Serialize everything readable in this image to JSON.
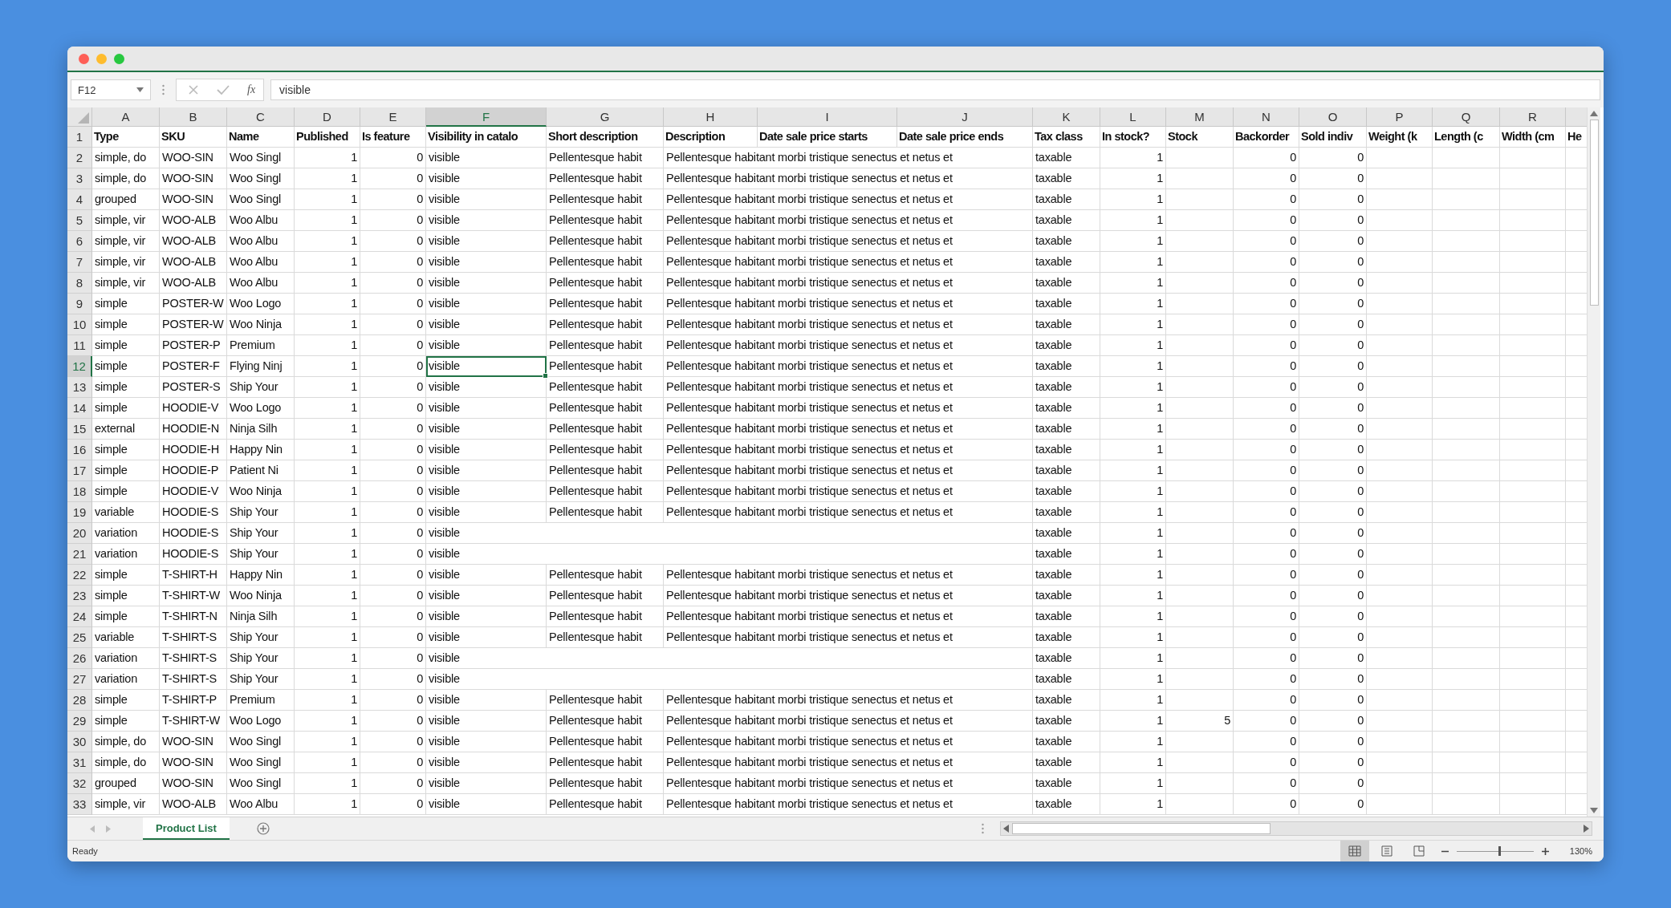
{
  "formula_bar": {
    "name_box": "F12",
    "function_label": "fx",
    "value": "visible"
  },
  "columns": [
    {
      "label": "A",
      "kind": "text",
      "selected": false
    },
    {
      "label": "B",
      "kind": "text",
      "selected": false
    },
    {
      "label": "C",
      "kind": "text",
      "selected": false
    },
    {
      "label": "D",
      "kind": "number",
      "selected": false
    },
    {
      "label": "E",
      "kind": "number",
      "selected": false
    },
    {
      "label": "F",
      "kind": "text",
      "selected": true
    },
    {
      "label": "G",
      "kind": "text",
      "selected": false
    },
    {
      "label": "H",
      "kind": "text",
      "selected": false
    },
    {
      "label": "I",
      "kind": "text",
      "selected": false
    },
    {
      "label": "J",
      "kind": "text",
      "selected": false
    },
    {
      "label": "K",
      "kind": "text",
      "selected": false
    },
    {
      "label": "L",
      "kind": "number",
      "selected": false
    },
    {
      "label": "M",
      "kind": "number",
      "selected": false
    },
    {
      "label": "N",
      "kind": "number",
      "selected": false
    },
    {
      "label": "O",
      "kind": "number",
      "selected": false
    },
    {
      "label": "P",
      "kind": "text",
      "selected": false
    },
    {
      "label": "Q",
      "kind": "text",
      "selected": false
    },
    {
      "label": "R",
      "kind": "text",
      "selected": false
    },
    {
      "kind": "text",
      "selected": false
    }
  ],
  "rows": [
    {
      "number": "1",
      "kind": "header",
      "selected": false,
      "cells": [
        "Type",
        "SKU",
        "Name",
        "Published",
        "Is feature",
        "Visibility in catalo",
        "Short description",
        "Description",
        "Date sale price starts",
        "Date sale price ends",
        "Tax class",
        "In stock?",
        "Stock",
        "Backorder",
        "Sold indiv",
        "Weight (k",
        "Length (c",
        "Width (cm",
        "He"
      ]
    },
    {
      "number": "2",
      "kind": "data",
      "selected": false,
      "cells": [
        "simple, do",
        "WOO-SIN",
        "Woo Singl",
        "1",
        "0",
        "visible",
        "Pellentesque habit",
        "Pellentesque habitant morbi tristique senectus et netus et",
        null,
        null,
        "taxable",
        "1",
        null,
        "0",
        "0",
        null,
        null,
        null,
        null
      ]
    },
    {
      "number": "3",
      "kind": "data",
      "selected": false,
      "cells": [
        "simple, do",
        "WOO-SIN",
        "Woo Singl",
        "1",
        "0",
        "visible",
        "Pellentesque habit",
        "Pellentesque habitant morbi tristique senectus et netus et",
        null,
        null,
        "taxable",
        "1",
        null,
        "0",
        "0",
        null,
        null,
        null,
        null
      ]
    },
    {
      "number": "4",
      "kind": "data",
      "selected": false,
      "cells": [
        "grouped",
        "WOO-SIN",
        "Woo Singl",
        "1",
        "0",
        "visible",
        "Pellentesque habit",
        "Pellentesque habitant morbi tristique senectus et netus et",
        null,
        null,
        "taxable",
        "1",
        null,
        "0",
        "0",
        null,
        null,
        null,
        null
      ]
    },
    {
      "number": "5",
      "kind": "data",
      "selected": false,
      "cells": [
        "simple, vir",
        "WOO-ALB",
        "Woo Albu",
        "1",
        "0",
        "visible",
        "Pellentesque habit",
        "Pellentesque habitant morbi tristique senectus et netus et",
        null,
        null,
        "taxable",
        "1",
        null,
        "0",
        "0",
        null,
        null,
        null,
        null
      ]
    },
    {
      "number": "6",
      "kind": "data",
      "selected": false,
      "cells": [
        "simple, vir",
        "WOO-ALB",
        "Woo Albu",
        "1",
        "0",
        "visible",
        "Pellentesque habit",
        "Pellentesque habitant morbi tristique senectus et netus et",
        null,
        null,
        "taxable",
        "1",
        null,
        "0",
        "0",
        null,
        null,
        null,
        null
      ]
    },
    {
      "number": "7",
      "kind": "data",
      "selected": false,
      "cells": [
        "simple, vir",
        "WOO-ALB",
        "Woo Albu",
        "1",
        "0",
        "visible",
        "Pellentesque habit",
        "Pellentesque habitant morbi tristique senectus et netus et",
        null,
        null,
        "taxable",
        "1",
        null,
        "0",
        "0",
        null,
        null,
        null,
        null
      ]
    },
    {
      "number": "8",
      "kind": "data",
      "selected": false,
      "cells": [
        "simple, vir",
        "WOO-ALB",
        "Woo Albu",
        "1",
        "0",
        "visible",
        "Pellentesque habit",
        "Pellentesque habitant morbi tristique senectus et netus et",
        null,
        null,
        "taxable",
        "1",
        null,
        "0",
        "0",
        null,
        null,
        null,
        null
      ]
    },
    {
      "number": "9",
      "kind": "data",
      "selected": false,
      "cells": [
        "simple",
        "POSTER-W",
        "Woo Logo",
        "1",
        "0",
        "visible",
        "Pellentesque habit",
        "Pellentesque habitant morbi tristique senectus et netus et",
        null,
        null,
        "taxable",
        "1",
        null,
        "0",
        "0",
        null,
        null,
        null,
        null
      ]
    },
    {
      "number": "10",
      "kind": "data",
      "selected": false,
      "cells": [
        "simple",
        "POSTER-W",
        "Woo Ninja",
        "1",
        "0",
        "visible",
        "Pellentesque habit",
        "Pellentesque habitant morbi tristique senectus et netus et",
        null,
        null,
        "taxable",
        "1",
        null,
        "0",
        "0",
        null,
        null,
        null,
        null
      ]
    },
    {
      "number": "11",
      "kind": "data",
      "selected": false,
      "cells": [
        "simple",
        "POSTER-P",
        "Premium",
        "1",
        "0",
        "visible",
        "Pellentesque habit",
        "Pellentesque habitant morbi tristique senectus et netus et",
        null,
        null,
        "taxable",
        "1",
        null,
        "0",
        "0",
        null,
        null,
        null,
        null
      ]
    },
    {
      "number": "12",
      "kind": "data",
      "selected": true,
      "cells": [
        "simple",
        "POSTER-F",
        "Flying Ninj",
        "1",
        "0",
        "visible",
        "Pellentesque habit",
        "Pellentesque habitant morbi tristique senectus et netus et",
        null,
        null,
        "taxable",
        "1",
        null,
        "0",
        "0",
        null,
        null,
        null,
        null
      ]
    },
    {
      "number": "13",
      "kind": "data",
      "selected": false,
      "cells": [
        "simple",
        "POSTER-S",
        "Ship Your",
        "1",
        "0",
        "visible",
        "Pellentesque habit",
        "Pellentesque habitant morbi tristique senectus et netus et",
        null,
        null,
        "taxable",
        "1",
        null,
        "0",
        "0",
        null,
        null,
        null,
        null
      ]
    },
    {
      "number": "14",
      "kind": "data",
      "selected": false,
      "cells": [
        "simple",
        "HOODIE-V",
        "Woo Logo",
        "1",
        "0",
        "visible",
        "Pellentesque habit",
        "Pellentesque habitant morbi tristique senectus et netus et",
        null,
        null,
        "taxable",
        "1",
        null,
        "0",
        "0",
        null,
        null,
        null,
        null
      ]
    },
    {
      "number": "15",
      "kind": "data",
      "selected": false,
      "cells": [
        "external",
        "HOODIE-N",
        "Ninja Silh",
        "1",
        "0",
        "visible",
        "Pellentesque habit",
        "Pellentesque habitant morbi tristique senectus et netus et",
        null,
        null,
        "taxable",
        "1",
        null,
        "0",
        "0",
        null,
        null,
        null,
        null
      ]
    },
    {
      "number": "16",
      "kind": "data",
      "selected": false,
      "cells": [
        "simple",
        "HOODIE-H",
        "Happy Nin",
        "1",
        "0",
        "visible",
        "Pellentesque habit",
        "Pellentesque habitant morbi tristique senectus et netus et",
        null,
        null,
        "taxable",
        "1",
        null,
        "0",
        "0",
        null,
        null,
        null,
        null
      ]
    },
    {
      "number": "17",
      "kind": "data",
      "selected": false,
      "cells": [
        "simple",
        "HOODIE-P",
        "Patient Ni",
        "1",
        "0",
        "visible",
        "Pellentesque habit",
        "Pellentesque habitant morbi tristique senectus et netus et",
        null,
        null,
        "taxable",
        "1",
        null,
        "0",
        "0",
        null,
        null,
        null,
        null
      ]
    },
    {
      "number": "18",
      "kind": "data",
      "selected": false,
      "cells": [
        "simple",
        "HOODIE-V",
        "Woo Ninja",
        "1",
        "0",
        "visible",
        "Pellentesque habit",
        "Pellentesque habitant morbi tristique senectus et netus et",
        null,
        null,
        "taxable",
        "1",
        null,
        "0",
        "0",
        null,
        null,
        null,
        null
      ]
    },
    {
      "number": "19",
      "kind": "data",
      "selected": false,
      "cells": [
        "variable",
        "HOODIE-S",
        "Ship Your",
        "1",
        "0",
        "visible",
        "Pellentesque habit",
        "Pellentesque habitant morbi tristique senectus et netus et",
        null,
        null,
        "taxable",
        "1",
        null,
        "0",
        "0",
        null,
        null,
        null,
        null
      ]
    },
    {
      "number": "20",
      "kind": "data",
      "selected": false,
      "cells": [
        "variation",
        "HOODIE-S",
        "Ship Your",
        "1",
        "0",
        "visible",
        null,
        null,
        null,
        null,
        "taxable",
        "1",
        null,
        "0",
        "0",
        null,
        null,
        null,
        null
      ]
    },
    {
      "number": "21",
      "kind": "data",
      "selected": false,
      "cells": [
        "variation",
        "HOODIE-S",
        "Ship Your",
        "1",
        "0",
        "visible",
        null,
        null,
        null,
        null,
        "taxable",
        "1",
        null,
        "0",
        "0",
        null,
        null,
        null,
        null
      ]
    },
    {
      "number": "22",
      "kind": "data",
      "selected": false,
      "cells": [
        "simple",
        "T-SHIRT-H",
        "Happy Nin",
        "1",
        "0",
        "visible",
        "Pellentesque habit",
        "Pellentesque habitant morbi tristique senectus et netus et",
        null,
        null,
        "taxable",
        "1",
        null,
        "0",
        "0",
        null,
        null,
        null,
        null
      ]
    },
    {
      "number": "23",
      "kind": "data",
      "selected": false,
      "cells": [
        "simple",
        "T-SHIRT-W",
        "Woo Ninja",
        "1",
        "0",
        "visible",
        "Pellentesque habit",
        "Pellentesque habitant morbi tristique senectus et netus et",
        null,
        null,
        "taxable",
        "1",
        null,
        "0",
        "0",
        null,
        null,
        null,
        null
      ]
    },
    {
      "number": "24",
      "kind": "data",
      "selected": false,
      "cells": [
        "simple",
        "T-SHIRT-N",
        "Ninja Silh",
        "1",
        "0",
        "visible",
        "Pellentesque habit",
        "Pellentesque habitant morbi tristique senectus et netus et",
        null,
        null,
        "taxable",
        "1",
        null,
        "0",
        "0",
        null,
        null,
        null,
        null
      ]
    },
    {
      "number": "25",
      "kind": "data",
      "selected": false,
      "cells": [
        "variable",
        "T-SHIRT-S",
        "Ship Your",
        "1",
        "0",
        "visible",
        "Pellentesque habit",
        "Pellentesque habitant morbi tristique senectus et netus et",
        null,
        null,
        "taxable",
        "1",
        null,
        "0",
        "0",
        null,
        null,
        null,
        null
      ]
    },
    {
      "number": "26",
      "kind": "data",
      "selected": false,
      "cells": [
        "variation",
        "T-SHIRT-S",
        "Ship Your",
        "1",
        "0",
        "visible",
        null,
        null,
        null,
        null,
        "taxable",
        "1",
        null,
        "0",
        "0",
        null,
        null,
        null,
        null
      ]
    },
    {
      "number": "27",
      "kind": "data",
      "selected": false,
      "cells": [
        "variation",
        "T-SHIRT-S",
        "Ship Your",
        "1",
        "0",
        "visible",
        null,
        null,
        null,
        null,
        "taxable",
        "1",
        null,
        "0",
        "0",
        null,
        null,
        null,
        null
      ]
    },
    {
      "number": "28",
      "kind": "data",
      "selected": false,
      "cells": [
        "simple",
        "T-SHIRT-P",
        "Premium",
        "1",
        "0",
        "visible",
        "Pellentesque habit",
        "Pellentesque habitant morbi tristique senectus et netus et",
        null,
        null,
        "taxable",
        "1",
        null,
        "0",
        "0",
        null,
        null,
        null,
        null
      ]
    },
    {
      "number": "29",
      "kind": "data",
      "selected": false,
      "cells": [
        "simple",
        "T-SHIRT-W",
        "Woo Logo",
        "1",
        "0",
        "visible",
        "Pellentesque habit",
        "Pellentesque habitant morbi tristique senectus et netus et",
        null,
        null,
        "taxable",
        "1",
        "5",
        "0",
        "0",
        null,
        null,
        null,
        null
      ]
    },
    {
      "number": "30",
      "kind": "data",
      "selected": false,
      "cells": [
        "simple, do",
        "WOO-SIN",
        "Woo Singl",
        "1",
        "0",
        "visible",
        "Pellentesque habit",
        "Pellentesque habitant morbi tristique senectus et netus et",
        null,
        null,
        "taxable",
        "1",
        null,
        "0",
        "0",
        null,
        null,
        null,
        null
      ]
    },
    {
      "number": "31",
      "kind": "data",
      "selected": false,
      "cells": [
        "simple, do",
        "WOO-SIN",
        "Woo Singl",
        "1",
        "0",
        "visible",
        "Pellentesque habit",
        "Pellentesque habitant morbi tristique senectus et netus et",
        null,
        null,
        "taxable",
        "1",
        null,
        "0",
        "0",
        null,
        null,
        null,
        null
      ]
    },
    {
      "number": "32",
      "kind": "data",
      "selected": false,
      "cells": [
        "grouped",
        "WOO-SIN",
        "Woo Singl",
        "1",
        "0",
        "visible",
        "Pellentesque habit",
        "Pellentesque habitant morbi tristique senectus et netus et",
        null,
        null,
        "taxable",
        "1",
        null,
        "0",
        "0",
        null,
        null,
        null,
        null
      ]
    },
    {
      "number": "33",
      "kind": "data",
      "selected": false,
      "cells": [
        "simple, vir",
        "WOO-ALB",
        "Woo Albu",
        "1",
        "0",
        "visible",
        "Pellentesque habit",
        "Pellentesque habitant morbi tristique senectus et netus et",
        null,
        null,
        "taxable",
        "1",
        null,
        "0",
        "0",
        null,
        null,
        null,
        null
      ]
    }
  ],
  "sheet_tabs": [
    {
      "label": "Product List",
      "selected": true
    }
  ],
  "status_bar": {
    "status": "Ready",
    "zoom": {
      "level": 0.55,
      "reading": "130%"
    }
  }
}
